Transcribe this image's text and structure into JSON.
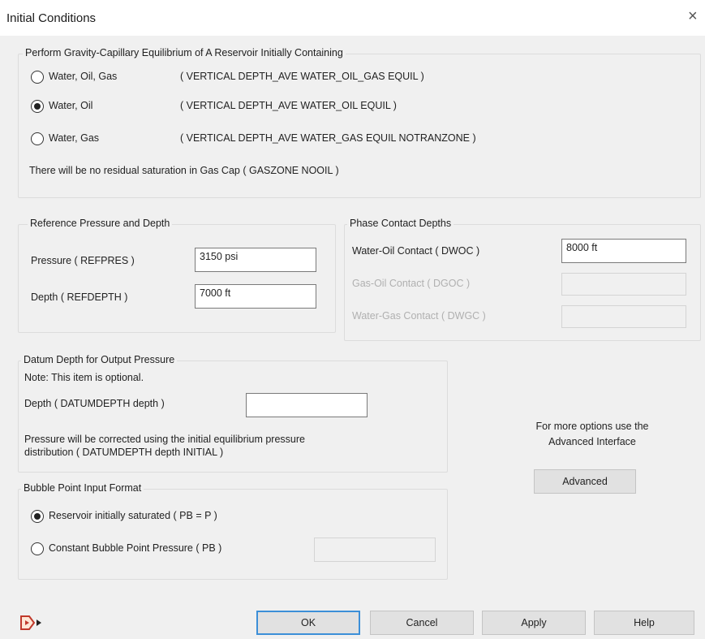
{
  "window": {
    "title": "Initial Conditions",
    "close_glyph": "×"
  },
  "equil_group": {
    "label": "Perform Gravity-Capillary Equilibrium of A Reservoir Initially Containing",
    "options": [
      {
        "label": "Water, Oil, Gas",
        "keyword": "( VERTICAL DEPTH_AVE WATER_OIL_GAS EQUIL )",
        "selected": false
      },
      {
        "label": "Water, Oil",
        "keyword": "( VERTICAL DEPTH_AVE WATER_OIL EQUIL )",
        "selected": true
      },
      {
        "label": "Water, Gas",
        "keyword": "( VERTICAL DEPTH_AVE WATER_GAS EQUIL NOTRANZONE )",
        "selected": false
      }
    ],
    "note": "There will be no residual saturation in Gas Cap ( GASZONE NOOIL )"
  },
  "ref_group": {
    "label": "Reference Pressure and Depth",
    "pressure_label": "Pressure ( REFPRES )",
    "pressure_value": "3150  psi",
    "depth_label": "Depth ( REFDEPTH )",
    "depth_value": "7000  ft"
  },
  "contact_group": {
    "label": "Phase Contact Depths",
    "dwoc_label": "Water-Oil Contact ( DWOC )",
    "dwoc_value": "8000  ft",
    "dgoc_label": "Gas-Oil Contact ( DGOC )",
    "dgoc_value": "",
    "dwgc_label": "Water-Gas Contact ( DWGC )",
    "dwgc_value": ""
  },
  "datum_group": {
    "label": "Datum Depth for Output Pressure",
    "note": "Note: This item is optional.",
    "depth_label": "Depth ( DATUMDEPTH depth )",
    "depth_value": "",
    "desc_line1": "Pressure will be corrected using the initial equilibrium pressure",
    "desc_line2": "distribution ( DATUMDEPTH depth INITIAL )"
  },
  "bubble_group": {
    "label": "Bubble Point Input Format",
    "options": [
      {
        "label": "Reservoir initially saturated ( PB = P )",
        "selected": true
      },
      {
        "label": "Constant Bubble Point Pressure ( PB )",
        "selected": false
      }
    ],
    "pb_value": ""
  },
  "advanced": {
    "line1": "For more options use the",
    "line2": "Advanced Interface",
    "button_label": "Advanced"
  },
  "footer": {
    "ok_label": "OK",
    "cancel_label": "Cancel",
    "apply_label": "Apply",
    "help_label": "Help",
    "tool_icon": "export-arrow-icon",
    "tool_color": "#c0392b"
  }
}
